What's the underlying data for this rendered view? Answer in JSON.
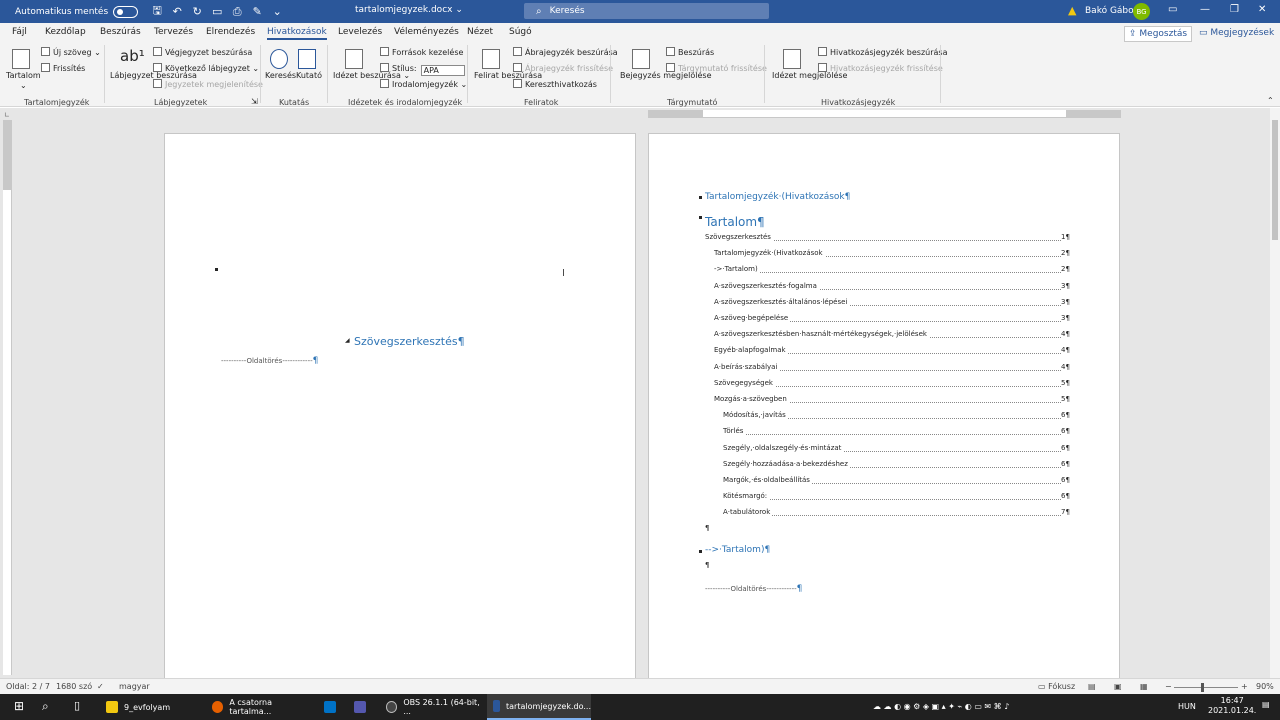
{
  "titlebar": {
    "autosave_label": "Automatikus mentés",
    "document_title": "tartalomjegyzek.docx",
    "search_placeholder": "Keresés",
    "user_name": "Bakó Gábor",
    "user_initials": "BG",
    "accent": "#2b579a"
  },
  "tabs": {
    "items": [
      "Fájl",
      "Kezdőlap",
      "Beszúrás",
      "Tervezés",
      "Elrendezés",
      "Hivatkozások",
      "Levelezés",
      "Véleményezés",
      "Nézet",
      "Súgó"
    ],
    "active": "Hivatkozások",
    "share_label": "Megosztás",
    "comments_label": "Megjegyzések"
  },
  "ribbon": {
    "toc": {
      "button": "Tartalom",
      "group": "Tartalomjegyzék",
      "new_text": "Új szöveg",
      "refresh": "Frissítés"
    },
    "footnotes": {
      "insert_footnote": "Lábjegyzet beszúrása",
      "insert_endnote": "Végjegyzet beszúrása",
      "next_footnote": "Következő lábjegyzet",
      "show_notes": "Jegyzetek megjelenítése",
      "group": "Lábjegyzetek"
    },
    "research": {
      "search": "Keresés",
      "researcher": "Kutató",
      "group": "Kutatás"
    },
    "citations": {
      "insert_citation": "Idézet beszúrása",
      "manage_sources": "Források kezelése",
      "style_label": "Stílus:",
      "style_value": "APA",
      "bibliography": "Irodalomjegyzék",
      "group": "Idézetek és irodalomjegyzék"
    },
    "captions": {
      "insert_caption": "Felirat beszúrása",
      "insert_table_of_figures": "Ábrajegyzék beszúrása",
      "update_table": "Ábrajegyzék frissítése",
      "cross_reference": "Kereszthivatkozás",
      "group": "Feliratok"
    },
    "index": {
      "mark_entry": "Bejegyzés megjelölése",
      "insert_index": "Beszúrás",
      "update_index": "Tárgymutató frissítése",
      "group": "Tárgymutató"
    },
    "authorities": {
      "mark_citation": "Idézet megjelölése",
      "insert_table": "Hivatkozásjegyzék beszúrása",
      "update_table": "Hivatkozásjegyzék frissítése",
      "group": "Hivatkozásjegyzék"
    }
  },
  "page1": {
    "heading": "Szövegszerkesztés¶",
    "page_break": "Oldaltörés"
  },
  "page2": {
    "heading_link": "Tartalomjegyzék·(Hivatkozások¶",
    "toc_title": "Tartalom¶",
    "toc": [
      {
        "text": "Szövegszerkesztés",
        "page": "1¶",
        "level": 1
      },
      {
        "text": "Tartalomjegyzék·(Hivatkozások",
        "page": "2¶",
        "level": 2
      },
      {
        "text": "->·Tartalom)",
        "page": "2¶",
        "level": 2
      },
      {
        "text": "A·szövegszerkesztés·fogalma",
        "page": "3¶",
        "level": 2
      },
      {
        "text": "A·szövegszerkesztés·általános·lépései",
        "page": "3¶",
        "level": 2
      },
      {
        "text": "A·szöveg·begépelése",
        "page": "3¶",
        "level": 2
      },
      {
        "text": "A·szövegszerkesztésben·használt·mértékegységek,·jelölések",
        "page": "4¶",
        "level": 2
      },
      {
        "text": "Egyéb·alapfogalmak",
        "page": "4¶",
        "level": 2
      },
      {
        "text": "A·beírás·szabályai",
        "page": "4¶",
        "level": 2
      },
      {
        "text": "Szövegegységek",
        "page": "5¶",
        "level": 2
      },
      {
        "text": "Mozgás·a·szövegben",
        "page": "5¶",
        "level": 2
      },
      {
        "text": "Módosítás,·javítás",
        "page": "6¶",
        "level": 3
      },
      {
        "text": "Törlés",
        "page": "6¶",
        "level": 3
      },
      {
        "text": "Szegély,·oldalszegély·és·mintázat",
        "page": "6¶",
        "level": 3
      },
      {
        "text": "Szegély·hozzáadása·a·bekezdéshez",
        "page": "6¶",
        "level": 3
      },
      {
        "text": "Margók,·és·oldalbeállítás",
        "page": "6¶",
        "level": 3
      },
      {
        "text": "Kötésmargó:",
        "page": "6¶",
        "level": 3
      },
      {
        "text": "A·tabulátorok",
        "page": "7¶",
        "level": 3
      }
    ],
    "para_mark": "¶",
    "link2": "-->·Tartalom)¶",
    "page_break": "Oldaltörés"
  },
  "statusbar": {
    "page": "Oldal: 2 / 7",
    "words": "1680 szó",
    "language": "magyar",
    "focus": "Fókusz",
    "zoom": "90%"
  },
  "taskbar": {
    "apps": [
      "9_evfolyam",
      "A csatorna tartalma...",
      "OBS 26.1.1 (64-bit, ...",
      "tartalomjegyzek.do..."
    ],
    "language": "HUN",
    "time": "16:47",
    "date": "2021.01.24."
  }
}
